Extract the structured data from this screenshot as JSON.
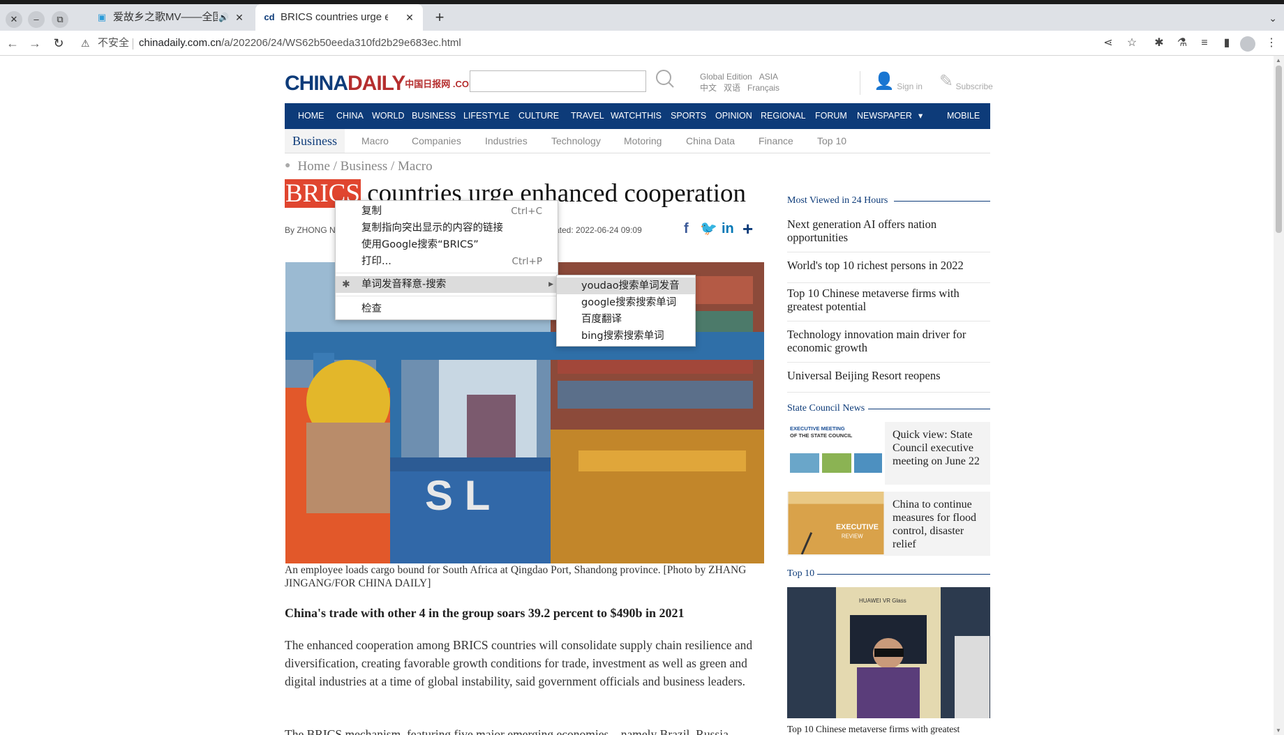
{
  "browser": {
    "tabs": [
      {
        "title": "爱故乡之歌MV——全国",
        "icon": "bilibili-icon"
      },
      {
        "title": "BRICS countries urge enh",
        "icon": "chinadaily-icon"
      }
    ],
    "new_tab": "+",
    "security_label": "不安全",
    "url_domain": "chinadaily.com.cn",
    "url_path": "/a/202206/24/WS62b50eeda310fd2b29e683ec.html"
  },
  "site": {
    "logo_main": "CHINA",
    "logo_daily": "DAILY",
    "logo_suffix": "中国日报网 .COM.CN",
    "edition_global": "Global Edition",
    "edition_asia": "ASIA",
    "edition_cn": "中文",
    "edition_bilingual": "双语",
    "edition_fr": "Français",
    "signin": "Sign in",
    "subscribe": "Subscribe"
  },
  "nav": {
    "items": [
      "HOME",
      "CHINA",
      "WORLD",
      "BUSINESS",
      "LIFESTYLE",
      "CULTURE",
      "TRAVEL",
      "WATCHTHIS",
      "SPORTS",
      "OPINION",
      "REGIONAL",
      "FORUM",
      "NEWSPAPER",
      "▾",
      "MOBILE"
    ]
  },
  "subnav": {
    "items": [
      "Business",
      "Macro",
      "Companies",
      "Industries",
      "Technology",
      "Motoring",
      "China Data",
      "Finance",
      "Top 10"
    ]
  },
  "article": {
    "breadcrumb": "Home / Business / Macro",
    "headline_highlight": "BRICS",
    "headline_rest": " countries urge enhanced cooperation",
    "byline": "By ZHONG N",
    "updated": "ated: 2022-06-24 09:09",
    "caption": "An employee loads cargo bound for South Africa at Qingdao Port, Shandong province. [Photo by ZHANG JINGANG/FOR CHINA DAILY]",
    "subhead": "China's trade with other 4 in the group soars 39.2 percent to $490b in 2021",
    "para1": "The enhanced cooperation among BRICS countries will consolidate supply chain resilience and diversification, creating favorable growth conditions for trade, investment as well as green and digital industries at a time of global instability, said government officials and business leaders.",
    "para2": "The BRICS mechanism, featuring five major emerging economies—namely Brazil, Russia,"
  },
  "rail": {
    "most_viewed_title": "Most Viewed in 24 Hours",
    "most_viewed": [
      "Next generation AI offers nation opportunities",
      "World's top 10 richest persons in 2022",
      "Top 10 Chinese metaverse firms with greatest potential",
      "Technology innovation main driver for economic growth",
      "Universal Beijing Resort reopens"
    ],
    "state_council_title": "State Council News",
    "state_council": [
      {
        "text": "Quick view: State Council executive meeting on June 22",
        "thumb_label": "EXECUTIVE MEETING OF THE STATE COUNCIL"
      },
      {
        "text": "China to continue measures for flood control, disaster relief",
        "thumb_label": "EXECUTIVE REVIEW"
      }
    ],
    "top10_title": "Top 10",
    "top10_caption": "Top 10 Chinese metaverse firms with greatest",
    "top10_img_label": "HUAWEI VR Glass"
  },
  "context_menu": {
    "items": [
      {
        "label": "复制",
        "shortcut": "Ctrl+C"
      },
      {
        "label": "复制指向突出显示的内容的链接",
        "shortcut": ""
      },
      {
        "label": "使用Google搜索“BRICS”",
        "shortcut": ""
      },
      {
        "label": "打印...",
        "shortcut": "Ctrl+P"
      },
      {
        "label": "单词发音释意-搜索",
        "shortcut": ""
      },
      {
        "label": "检查",
        "shortcut": ""
      }
    ],
    "submenu": [
      "youdao搜索单词发音",
      "google搜索搜索单词",
      "百度翻译",
      "bing搜索搜索单词"
    ]
  },
  "colors": {
    "brand_blue": "#0d3b79",
    "brand_red": "#b52e2e",
    "highlight": "#e0452f"
  }
}
